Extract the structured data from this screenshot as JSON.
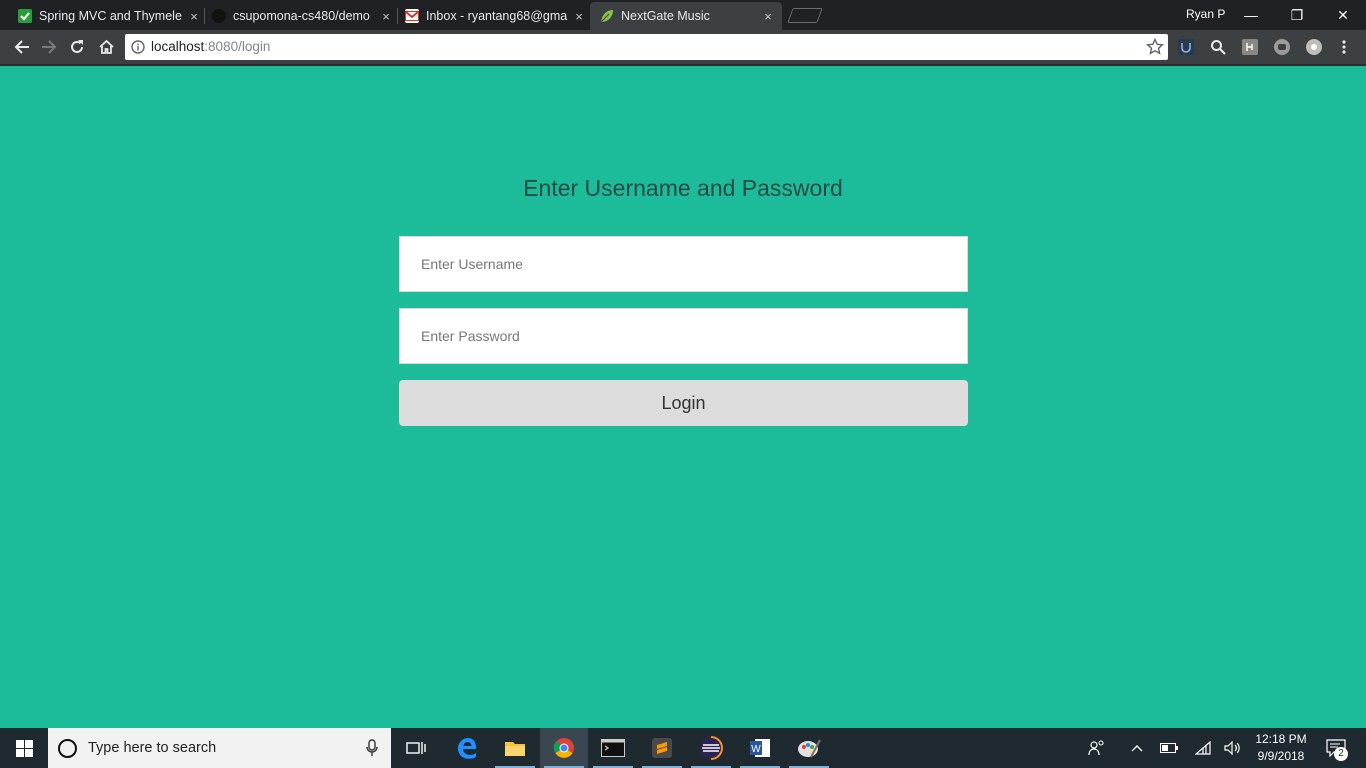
{
  "browser": {
    "tabs": [
      {
        "title": "Spring MVC and Thymele",
        "close": "×",
        "icon": "spring-check-icon"
      },
      {
        "title": "csupomona-cs480/demo",
        "close": "×",
        "icon": "github-icon"
      },
      {
        "title": "Inbox - ryantang68@gma",
        "close": "×",
        "icon": "gmail-icon"
      },
      {
        "title": "NextGate Music",
        "close": "×",
        "icon": "spring-leaf-icon"
      }
    ],
    "profile_name": "Ryan P",
    "url_host": "localhost",
    "url_path": ":8080/login",
    "window_controls": {
      "minimize": "—",
      "restore": "❐",
      "close": "✕"
    }
  },
  "page": {
    "heading": "Enter Username and Password",
    "username_placeholder": "Enter Username",
    "password_placeholder": "Enter Password",
    "login_label": "Login",
    "background_color": "#1cbc9b"
  },
  "taskbar": {
    "search_placeholder": "Type here to search",
    "apps": [
      "task-view",
      "edge",
      "file-explorer",
      "chrome",
      "terminal",
      "sublime-text",
      "eclipse",
      "word",
      "paint"
    ],
    "time": "12:18 PM",
    "date": "9/9/2018",
    "notification_count": "2"
  }
}
